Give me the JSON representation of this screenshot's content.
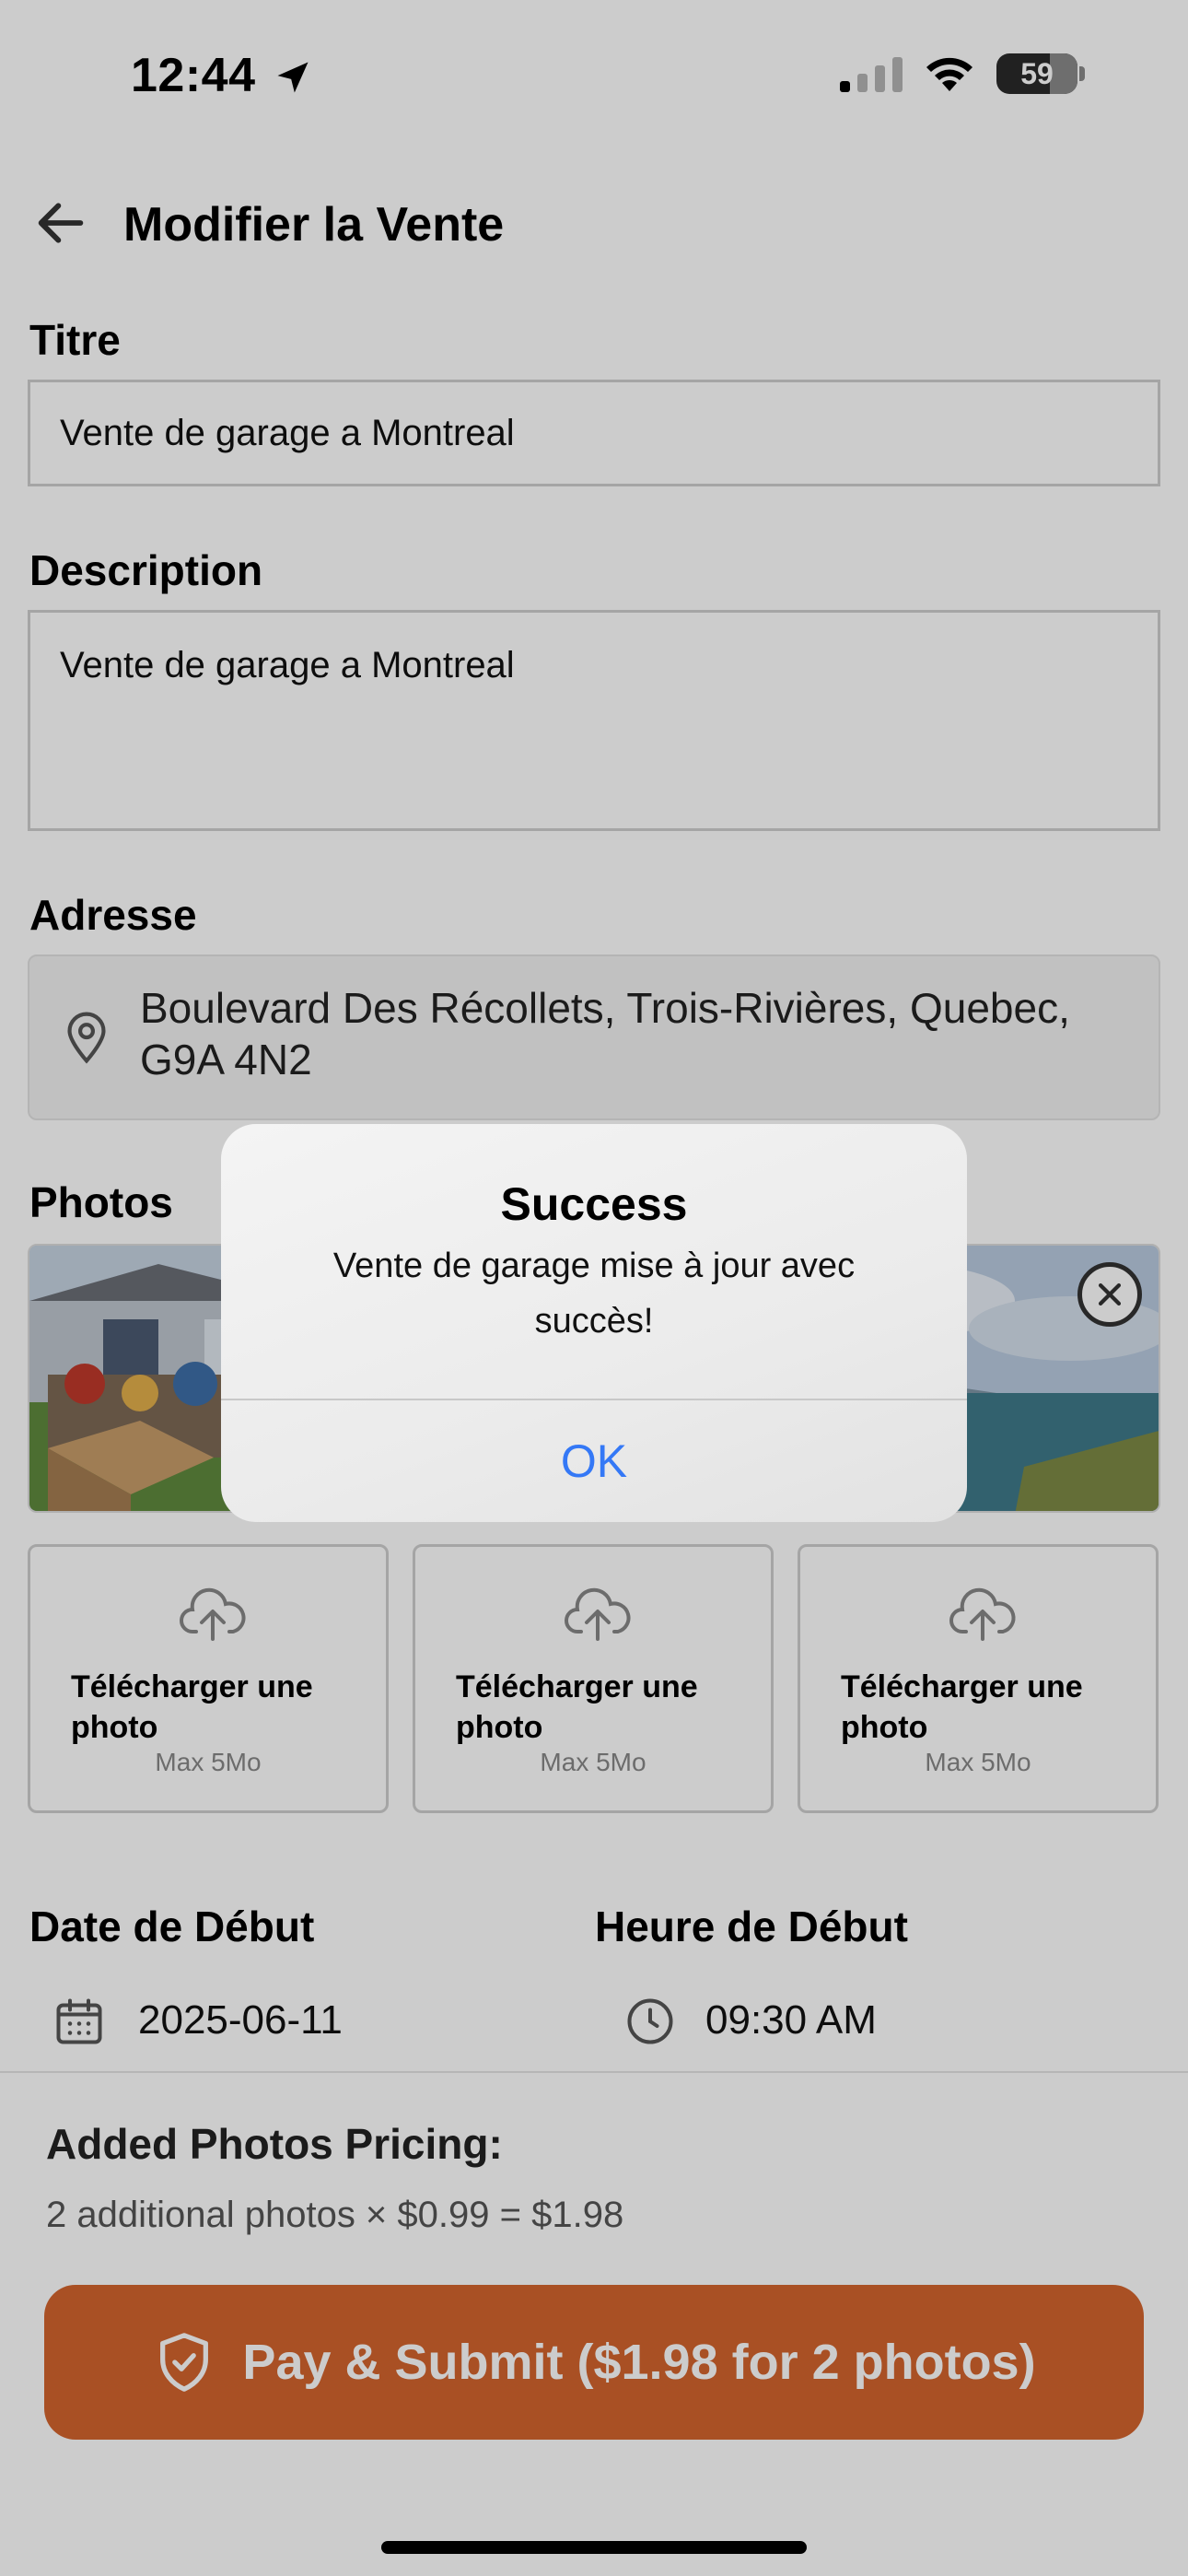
{
  "status_bar": {
    "time": "12:44",
    "battery": "59"
  },
  "header": {
    "title": "Modifier la Vente"
  },
  "form": {
    "title_label": "Titre",
    "title_value": "Vente de garage a Montreal",
    "description_label": "Description",
    "description_value": "Vente de garage a Montreal",
    "address_label": "Adresse",
    "address_value": "Boulevard Des Récollets, Trois-Rivières, Quebec, G9A 4N2",
    "photos_label": "Photos",
    "uploads": [
      {
        "title": "Télécharger une photo",
        "subtitle": "Max 5Mo"
      },
      {
        "title": "Télécharger une photo",
        "subtitle": "Max 5Mo"
      },
      {
        "title": "Télécharger une photo",
        "subtitle": "Max 5Mo"
      }
    ],
    "start_date_label": "Date de Début",
    "start_date_value": "2025-06-11",
    "start_time_label": "Heure de Début",
    "start_time_value": "09:30 AM"
  },
  "pricing": {
    "title": "Added Photos Pricing:",
    "detail": "2 additional photos × $0.99 = $1.98",
    "pay_button": "Pay & Submit ($1.98 for 2 photos)"
  },
  "alert": {
    "title": "Success",
    "message": "Vente de garage mise à jour avec succès!",
    "ok": "OK"
  },
  "colors": {
    "accent": "#d4642e",
    "link": "#3478f6"
  }
}
